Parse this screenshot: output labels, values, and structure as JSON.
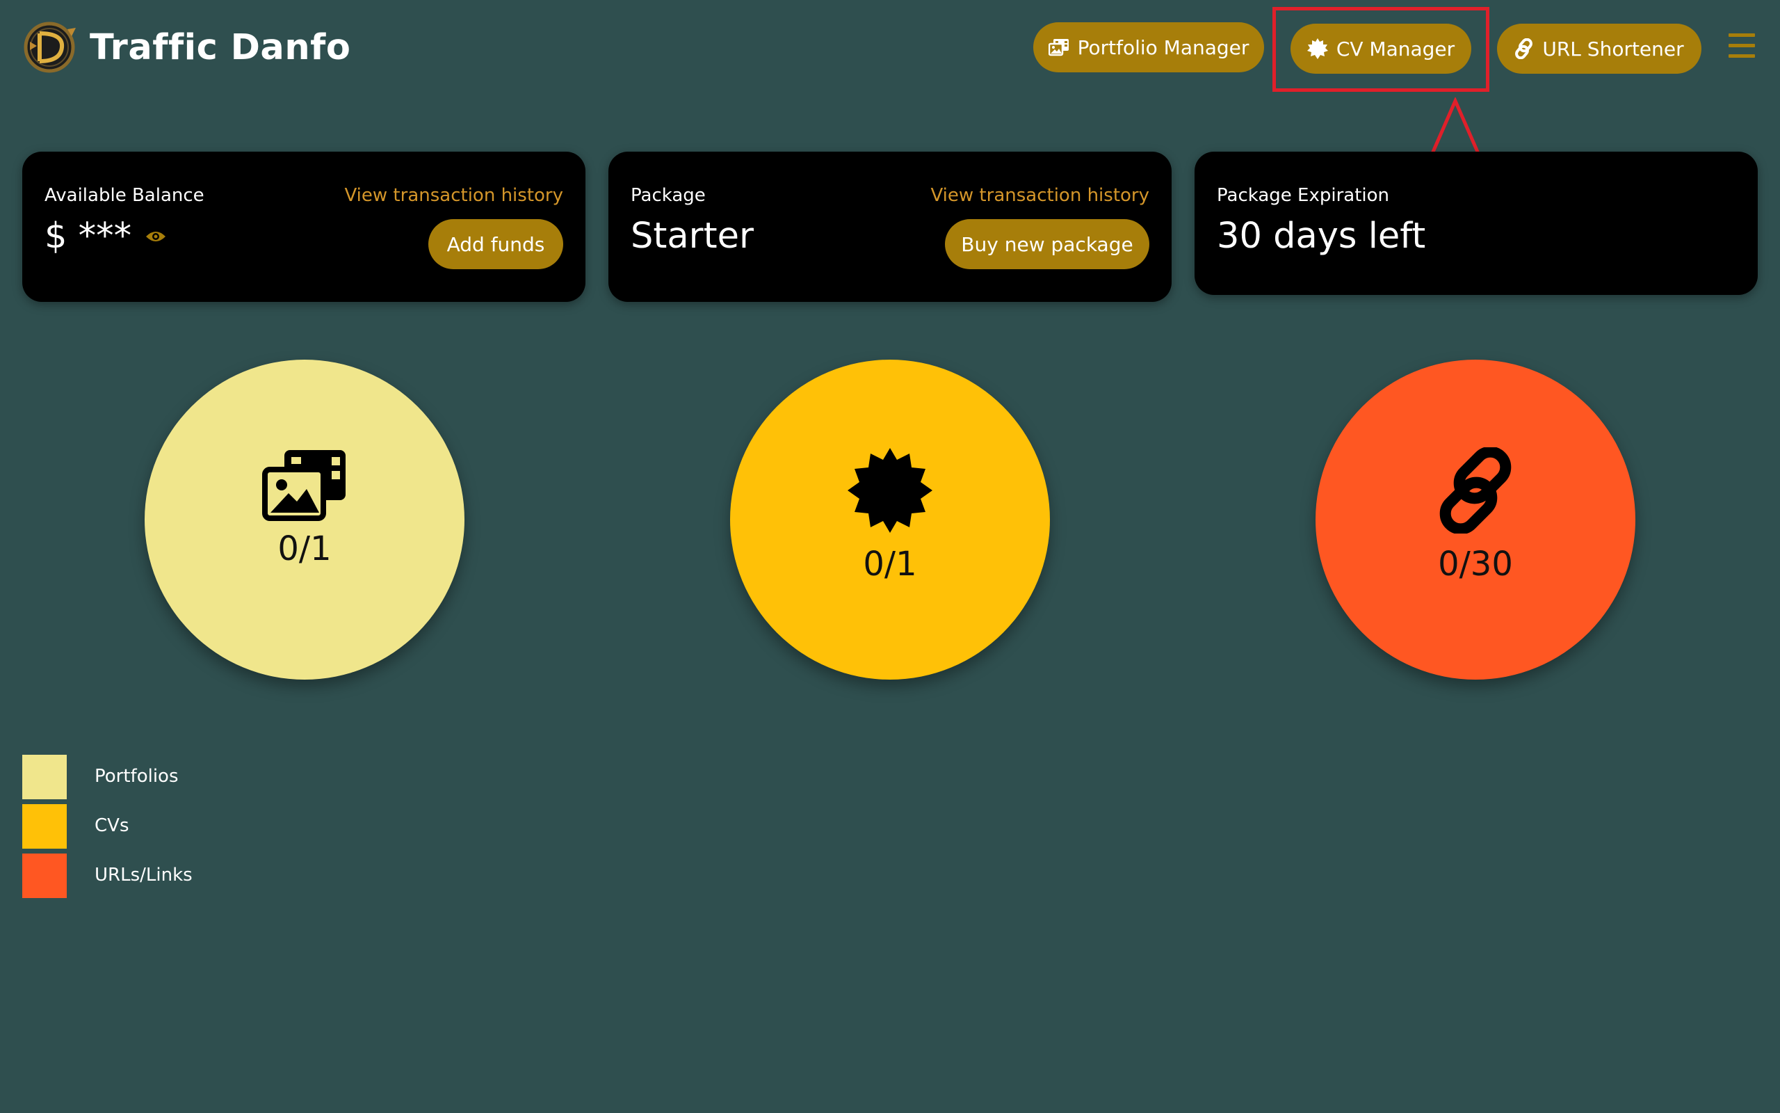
{
  "header": {
    "brand": "Traffic Danfo",
    "nav": [
      {
        "label": "Portfolio Manager",
        "icon": "images-icon"
      },
      {
        "label": "CV Manager",
        "icon": "certificate-icon"
      },
      {
        "label": "URL Shortener",
        "icon": "link-icon"
      }
    ],
    "menu_icon": "hamburger-menu-icon"
  },
  "cards": {
    "balance": {
      "label": "Available Balance",
      "value": "$ ***",
      "link": "View transaction history",
      "button": "Add funds"
    },
    "package": {
      "label": "Package",
      "value": "Starter",
      "link": "View transaction history",
      "button": "Buy new package"
    },
    "expiration": {
      "label": "Package Expiration",
      "value": "30 days left"
    }
  },
  "stats": [
    {
      "count": "0/1",
      "icon": "images-icon",
      "color": "#f0e68c"
    },
    {
      "count": "0/1",
      "icon": "certificate-icon",
      "color": "#ffc107"
    },
    {
      "count": "0/30",
      "icon": "link-icon",
      "color": "#ff5722"
    }
  ],
  "legend": [
    {
      "label": "Portfolios",
      "color": "#f0e68c"
    },
    {
      "label": "CVs",
      "color": "#ffc107"
    },
    {
      "label": "URLs/Links",
      "color": "#ff5722"
    }
  ],
  "colors": {
    "background": "#2f4f4f",
    "accent": "#a77e0a",
    "link": "#d4962a",
    "card": "#000000",
    "annotation": "#e0202a"
  }
}
